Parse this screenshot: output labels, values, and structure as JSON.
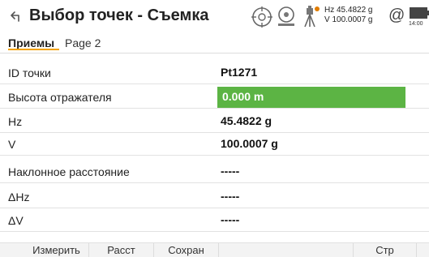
{
  "title": "Выбор точек - Съемка",
  "status": {
    "hz_label": "Hz 45.4822 g",
    "v_label": "V 100.0007 g",
    "battery_text": "14:00",
    "level_color": "#888888"
  },
  "tabs": [
    {
      "label": "Приемы"
    },
    {
      "label": "Page 2"
    }
  ],
  "rows": [
    {
      "label": "ID точки",
      "value": "Pt1271"
    },
    {
      "label": "Высота отражателя",
      "value": "0.000 m"
    },
    {
      "label": "Hz",
      "value": "45.4822 g"
    },
    {
      "label": "V",
      "value": "100.0007 g"
    },
    {
      "label": "Наклонное расстояние",
      "value": "-----"
    },
    {
      "label": "ΔHz",
      "value": "-----"
    },
    {
      "label": "ΔV",
      "value": "-----"
    }
  ],
  "toolbar": {
    "measure": "Измерить",
    "dist": "Расст",
    "save": "Сохран",
    "page": "Стр"
  }
}
